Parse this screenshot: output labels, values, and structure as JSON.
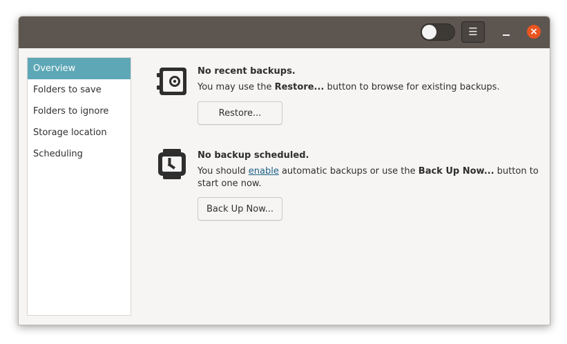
{
  "titlebar": {
    "toggle_state": "off",
    "menu_icon": "hamburger-menu-icon",
    "minimize_icon": "minimize-icon",
    "close_icon": "close-icon",
    "close_color": "#e95420"
  },
  "sidebar": {
    "items": [
      {
        "label": "Overview",
        "selected": true
      },
      {
        "label": "Folders to save"
      },
      {
        "label": "Folders to ignore"
      },
      {
        "label": "Storage location"
      },
      {
        "label": "Scheduling"
      }
    ]
  },
  "restore_section": {
    "icon": "safe-icon",
    "heading": "No recent backups.",
    "text_before": "You may use the ",
    "text_bold": "Restore...",
    "text_after": " button to browse for existing backups.",
    "button_label": "Restore..."
  },
  "schedule_section": {
    "icon": "watch-icon",
    "heading": "No backup scheduled.",
    "text_before": "You should ",
    "link_text": "enable",
    "text_middle": " automatic backups or use the ",
    "text_bold": "Back Up Now...",
    "text_after": " button to",
    "text_line2": "start one now.",
    "button_label": "Back Up Now..."
  },
  "colors": {
    "selection": "#5ea7b6",
    "titlebar": "#5d5650",
    "link": "#1c5f84"
  }
}
